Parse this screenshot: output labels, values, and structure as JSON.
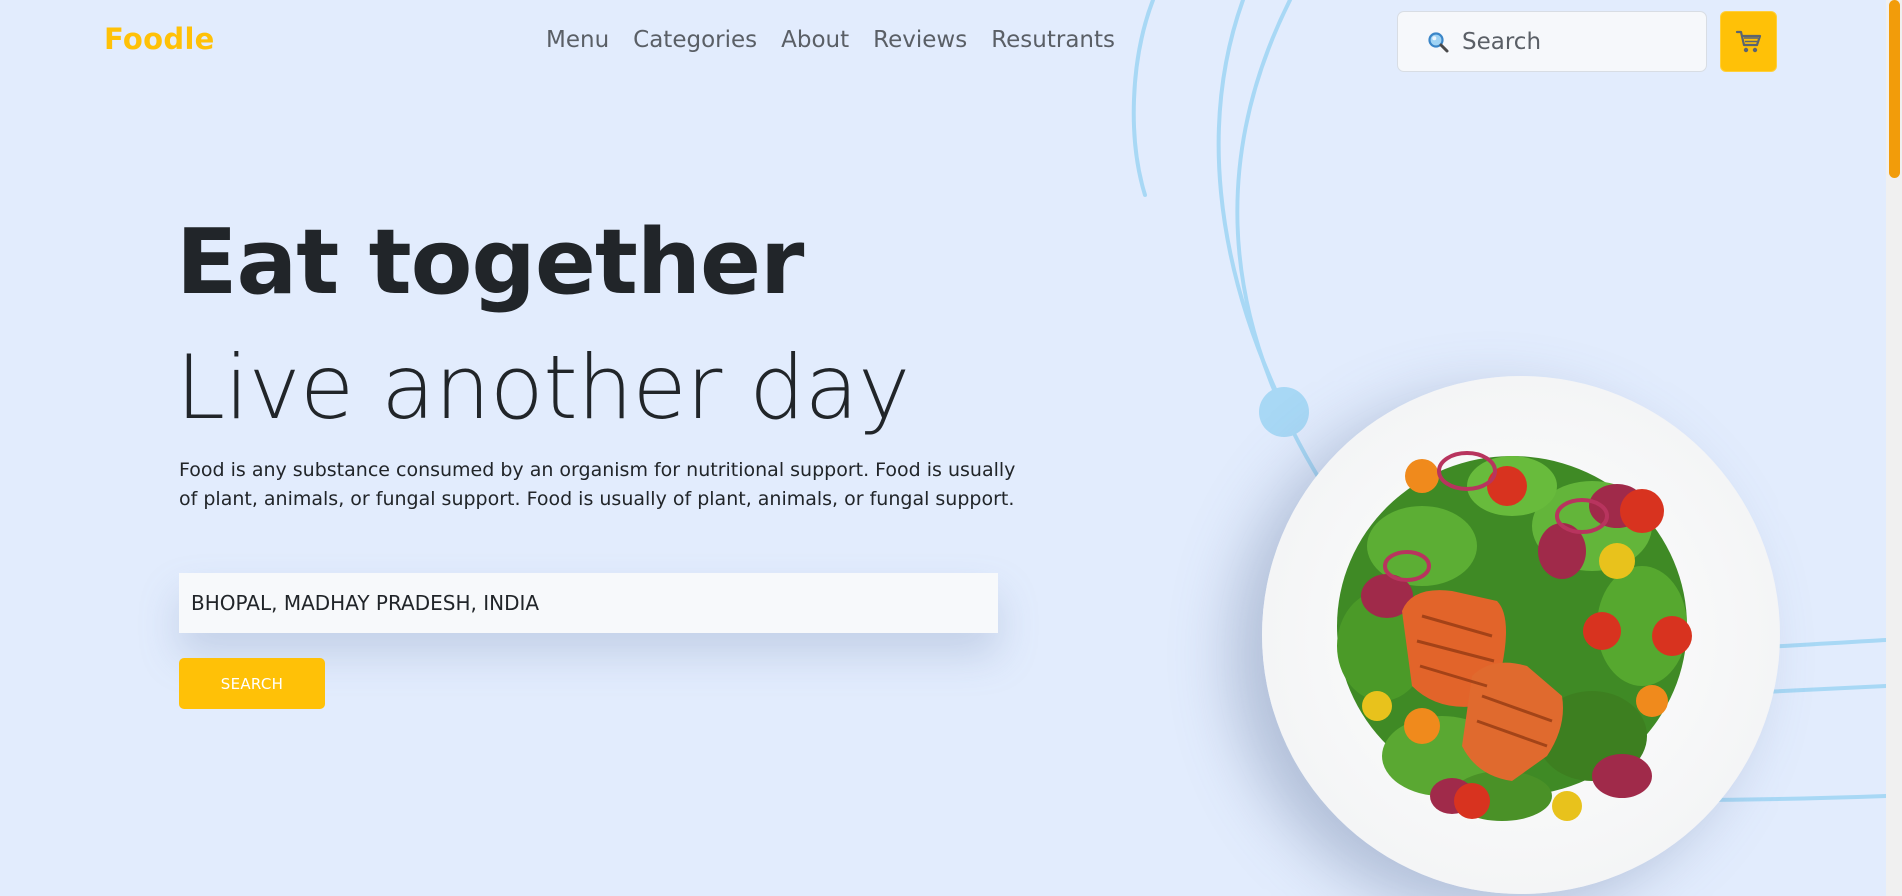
{
  "brand": {
    "logo": "Foodle",
    "accent_color": "#ffc107"
  },
  "nav": {
    "items": [
      {
        "label": "Menu"
      },
      {
        "label": "Categories"
      },
      {
        "label": "About"
      },
      {
        "label": "Reviews"
      },
      {
        "label": "Resutrants"
      }
    ]
  },
  "header_search": {
    "placeholder": "Search",
    "icon": "magnifier-icon"
  },
  "cart": {
    "icon": "cart-icon"
  },
  "hero": {
    "title": "Eat together",
    "subtitle": "Live another day",
    "description": "Food is any substance consumed by an organism for nutritional support. Food is usually of plant, animals, or fungal support. Food is usually of plant, animals, or fungal support.",
    "location_value": "BHOPAL, MADHAY PRADESH, INDIA",
    "search_button": "SEARCH"
  },
  "hero_image": {
    "description_icon": "salad-plate-image"
  }
}
